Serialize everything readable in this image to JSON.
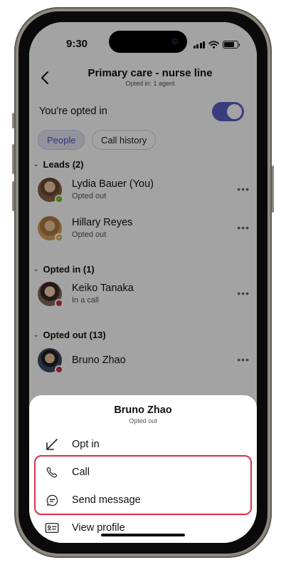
{
  "status_bar": {
    "time": "9:30"
  },
  "header": {
    "title": "Primary care - nurse line",
    "subtitle": "Opted in: 1 agent"
  },
  "opt_in": {
    "label": "You're opted in",
    "enabled": true
  },
  "tabs": [
    {
      "label": "People",
      "active": true
    },
    {
      "label": "Call history",
      "active": false
    }
  ],
  "sections": [
    {
      "title": "Leads (2)",
      "people": [
        {
          "name": "Lydia Bauer (You)",
          "status": "Opted out",
          "presence": "available"
        },
        {
          "name": "Hillary Reyes",
          "status": "Opted out",
          "presence": "away"
        }
      ]
    },
    {
      "title": "Opted in (1)",
      "people": [
        {
          "name": "Keiko Tanaka",
          "status": "In a call",
          "presence": "busy"
        }
      ]
    },
    {
      "title": "Opted out (13)",
      "people": [
        {
          "name": "Bruno Zhao",
          "status": "",
          "presence": "busy"
        }
      ]
    }
  ],
  "sheet": {
    "name": "Bruno Zhao",
    "status": "Opted out",
    "actions": [
      {
        "label": "Opt in",
        "icon": "arrow-down-left-icon"
      },
      {
        "label": "Call",
        "icon": "phone-icon"
      },
      {
        "label": "Send message",
        "icon": "chat-icon"
      },
      {
        "label": "View profile",
        "icon": "contact-card-icon"
      }
    ]
  },
  "colors": {
    "accent": "#5b5fc7",
    "presence_available": "#6bb700",
    "presence_away": "#e9a23b",
    "presence_busy": "#c4314b",
    "highlight_outline": "#d8304a"
  }
}
